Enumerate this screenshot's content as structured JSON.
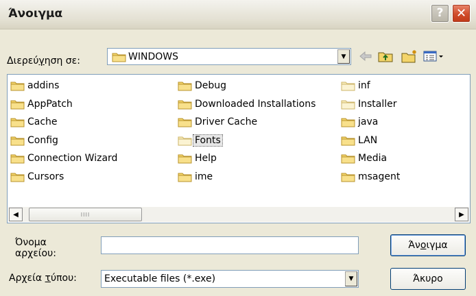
{
  "window": {
    "title": "Άνοιγμα",
    "help_glyph": "?",
    "close_glyph": "✕"
  },
  "lookin": {
    "label_pre": "Διερεύ",
    "label_u": "γ",
    "label_post": "ηση σε:",
    "value": "WINDOWS",
    "toolbar": [
      "back-icon",
      "up-folder-icon",
      "new-folder-icon",
      "views-menu-icon"
    ]
  },
  "files": {
    "col1": [
      "addins",
      "AppPatch",
      "Cache",
      "Config",
      "Connection Wizard",
      "Cursors"
    ],
    "col2": [
      "Debug",
      "Downloaded Installations",
      "Driver Cache",
      "Fonts",
      "Help",
      "ime"
    ],
    "col3": [
      "inf",
      "Installer",
      "java",
      "LAN",
      "Media",
      "msagent"
    ],
    "selected": "Fonts",
    "colors": {
      "folder": "#f3d46a",
      "folder_pale": "#f8ecb9",
      "selection": "#e6e6e6"
    }
  },
  "filename": {
    "label_line1": "Όνομα",
    "label_line2_pre": "αρ",
    "label_line2_u": "χ",
    "label_line2_post": "είου:",
    "value": ""
  },
  "filetype": {
    "label_pre": "Αρχεία ",
    "label_u": "τ",
    "label_post": "ύπου:",
    "value": "Executable files (*.exe)"
  },
  "buttons": {
    "open_pre": "Άν",
    "open_u": "ο",
    "open_post": "ιγμα",
    "cancel": "Άκυρο"
  },
  "scrollbar": {
    "thumb_grip": "IIII"
  }
}
